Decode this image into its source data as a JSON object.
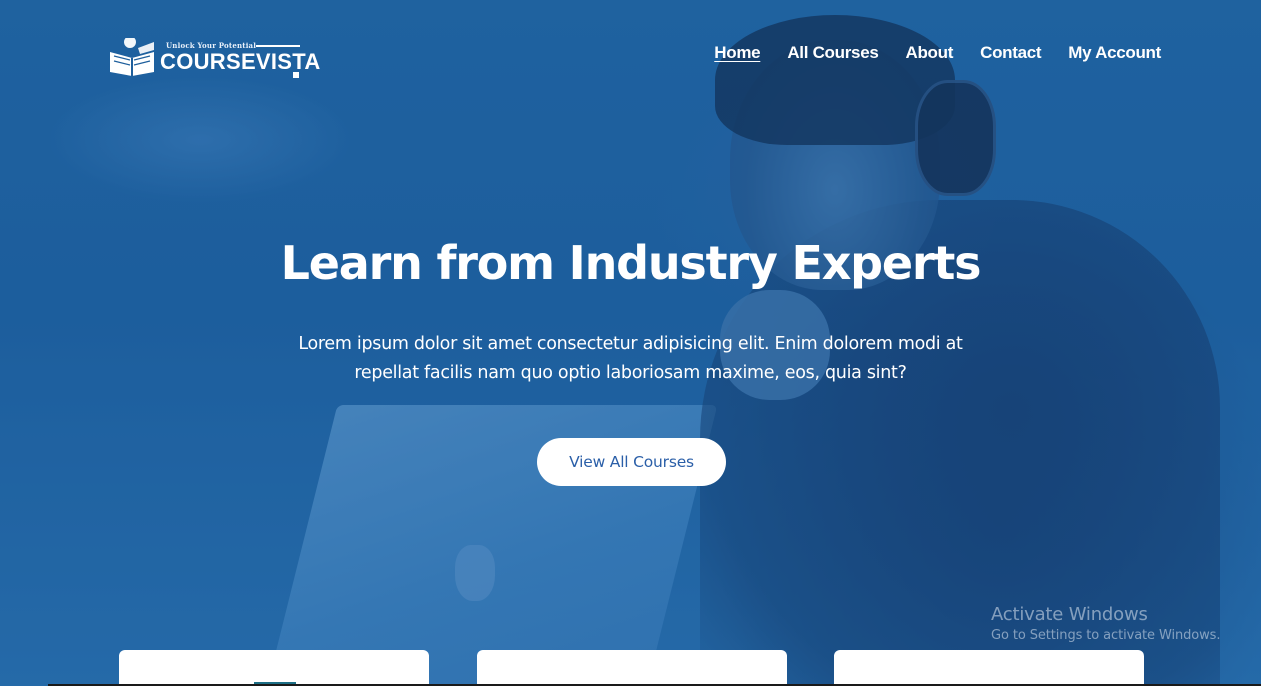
{
  "header": {
    "logo": {
      "tagline": "Unlock Your Potential",
      "brand": "COURSEVISTA"
    },
    "nav": [
      {
        "label": "Home",
        "active": true
      },
      {
        "label": "All Courses",
        "active": false
      },
      {
        "label": "About",
        "active": false
      },
      {
        "label": "Contact",
        "active": false
      },
      {
        "label": "My Account",
        "active": false
      }
    ]
  },
  "hero": {
    "title": "Learn from Industry Experts",
    "description": "Lorem ipsum dolor sit amet consectetur adipisicing elit. Enim dolorem modi at repellat facilis nam quo optio laboriosam maxime, eos, quia sint?",
    "cta_label": "View All Courses"
  },
  "watermark": {
    "title": "Activate Windows",
    "subtitle": "Go to Settings to activate Windows."
  },
  "colors": {
    "hero_overlay": "#1e5f9c",
    "cta_text": "#2b5fa8",
    "text": "#ffffff"
  }
}
